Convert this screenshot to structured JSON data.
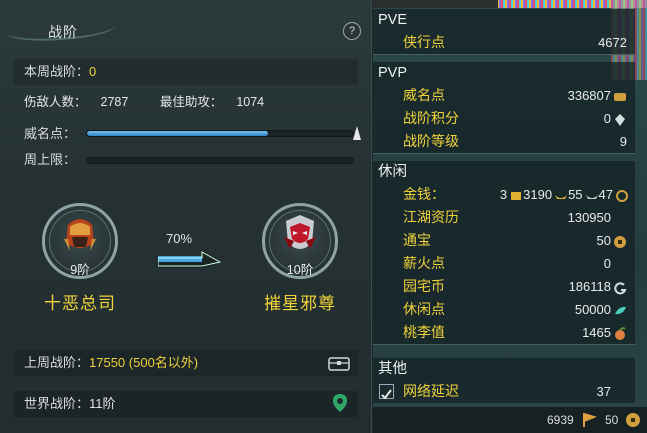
{
  "left": {
    "title": "战阶",
    "help": "?",
    "week_rank_label": "本周战阶：",
    "week_rank_value": "0",
    "kills_label": "伤敌人数：",
    "kills_value": "2787",
    "assist_label": "最佳助攻：",
    "assist_value": "1074",
    "prestige_label": "威名点：",
    "prestige_progress": 0.68,
    "weekly_cap_label": "周上限：",
    "weekly_cap_progress": 0.0,
    "current_rank": {
      "level": "9阶",
      "name": "十恶总司"
    },
    "next_rank": {
      "level": "10阶",
      "name": "摧星邪尊"
    },
    "progress_pct": "70%",
    "last_week_label": "上周战阶：",
    "last_week_value": "17550 (500名以外)",
    "world_rank_label": "世界战阶：",
    "world_rank_value": "11阶"
  },
  "right": {
    "pve": {
      "header": "PVE",
      "items": [
        {
          "label": "侠行点",
          "value": "4672"
        }
      ]
    },
    "pvp": {
      "header": "PVP",
      "items": [
        {
          "label": "威名点",
          "value": "336807"
        },
        {
          "label": "战阶积分",
          "value": "0"
        },
        {
          "label": "战阶等级",
          "value": "9"
        }
      ]
    },
    "leisure": {
      "header": "休闲",
      "money_label": "金钱：",
      "money_gold": "3",
      "money_silver": "3190",
      "money_copper1": "55",
      "money_copper2": "47",
      "items": [
        {
          "label": "江湖资历",
          "value": "130950"
        },
        {
          "label": "通宝",
          "value": "50"
        },
        {
          "label": "薪火点",
          "value": "0"
        },
        {
          "label": "园宅币",
          "value": "186118"
        },
        {
          "label": "休闲点",
          "value": "50000"
        },
        {
          "label": "桃李值",
          "value": "1465"
        }
      ]
    },
    "other": {
      "header": "其他",
      "latency_label": "网络延迟",
      "latency_value": "37"
    },
    "bottom": {
      "coins": "6939",
      "tongbao": "50"
    }
  },
  "colors": {
    "accent": "#f0d23a",
    "bar": "#3d8fd0"
  }
}
